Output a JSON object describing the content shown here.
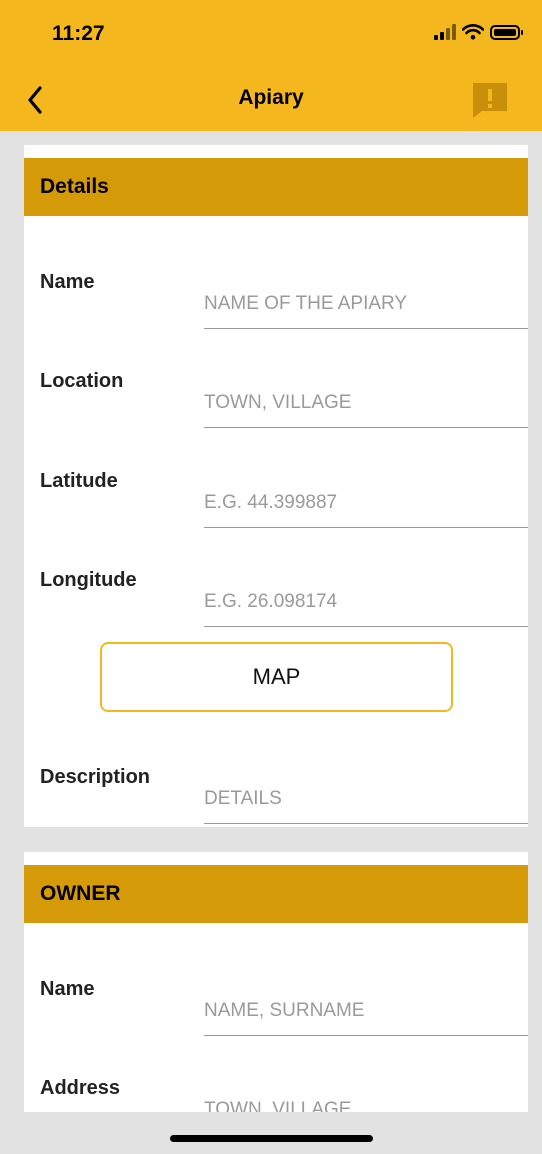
{
  "status_bar": {
    "time": "11:27"
  },
  "nav": {
    "title": "Apiary"
  },
  "details": {
    "header": "Details",
    "name": {
      "label": "Name",
      "placeholder": "NAME OF THE APIARY"
    },
    "location": {
      "label": "Location",
      "placeholder": "TOWN, VILLAGE"
    },
    "latitude": {
      "label": "Latitude",
      "placeholder": "E.G. 44.399887"
    },
    "longitude": {
      "label": "Longitude",
      "placeholder": "E.G. 26.098174"
    },
    "map_button": "MAP",
    "description": {
      "label": "Description",
      "placeholder": "DETAILS"
    }
  },
  "owner": {
    "header": "OWNER",
    "name": {
      "label": "Name",
      "placeholder": "NAME, SURNAME"
    },
    "address": {
      "label": "Address",
      "placeholder": "TOWN, VILLAGE"
    }
  },
  "colors": {
    "header_bg": "#f4b81e",
    "section_header_bg": "#d49a08",
    "report_icon_bg": "#c8900a",
    "page_bg": "#e2e2e2"
  },
  "icons": {
    "back": "chevron-left-icon",
    "report": "report-exclamation-icon",
    "signal": "signal-icon",
    "wifi": "wifi-icon",
    "battery": "battery-icon"
  }
}
